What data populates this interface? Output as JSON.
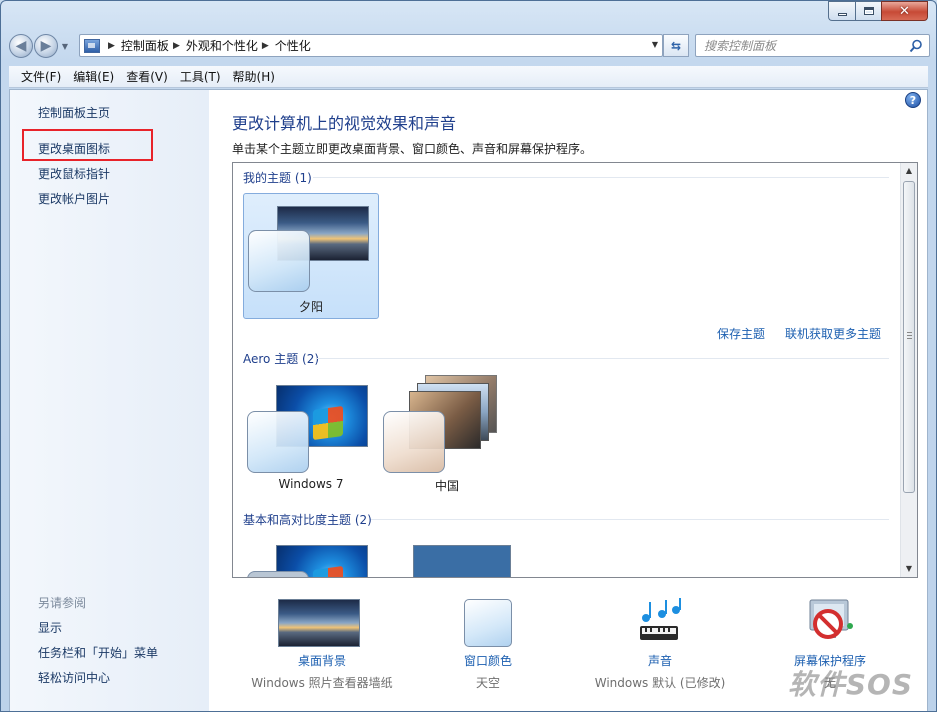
{
  "address": {
    "crumbs": [
      "控制面板",
      "外观和个性化",
      "个性化"
    ],
    "search_placeholder": "搜索控制面板"
  },
  "menu": [
    "文件(F)",
    "编辑(E)",
    "查看(V)",
    "工具(T)",
    "帮助(H)"
  ],
  "sidebar": {
    "links": [
      "控制面板主页",
      "更改桌面图标",
      "更改鼠标指针",
      "更改帐户图片"
    ],
    "see_also_header": "另请参阅",
    "see_also": [
      "显示",
      "任务栏和「开始」菜单",
      "轻松访问中心"
    ]
  },
  "content": {
    "title": "更改计算机上的视觉效果和声音",
    "subtitle": "单击某个主题立即更改桌面背景、窗口颜色、声音和屏幕保护程序。",
    "groups": {
      "my_themes": "我的主题 (1)",
      "aero_themes": "Aero 主题 (2)",
      "basic_themes": "基本和高对比度主题 (2)"
    },
    "themes": {
      "sunset": "夕阳",
      "windows7": "Windows 7",
      "china": "中国"
    },
    "save_theme": "保存主题",
    "get_more": "联机获取更多主题"
  },
  "tools": [
    {
      "label": "桌面背景",
      "sub": "Windows 照片查看器墙纸"
    },
    {
      "label": "窗口颜色",
      "sub": "天空"
    },
    {
      "label": "声音",
      "sub": "Windows 默认 (已修改)"
    },
    {
      "label": "屏幕保护程序",
      "sub": "无"
    }
  ],
  "watermark": "软件SOS",
  "icons": [
    "back-arrow-icon",
    "forward-arrow-icon",
    "control-panel-icon",
    "refresh-icon",
    "search-icon",
    "help-icon",
    "music-notes-icon",
    "no-entry-icon"
  ]
}
